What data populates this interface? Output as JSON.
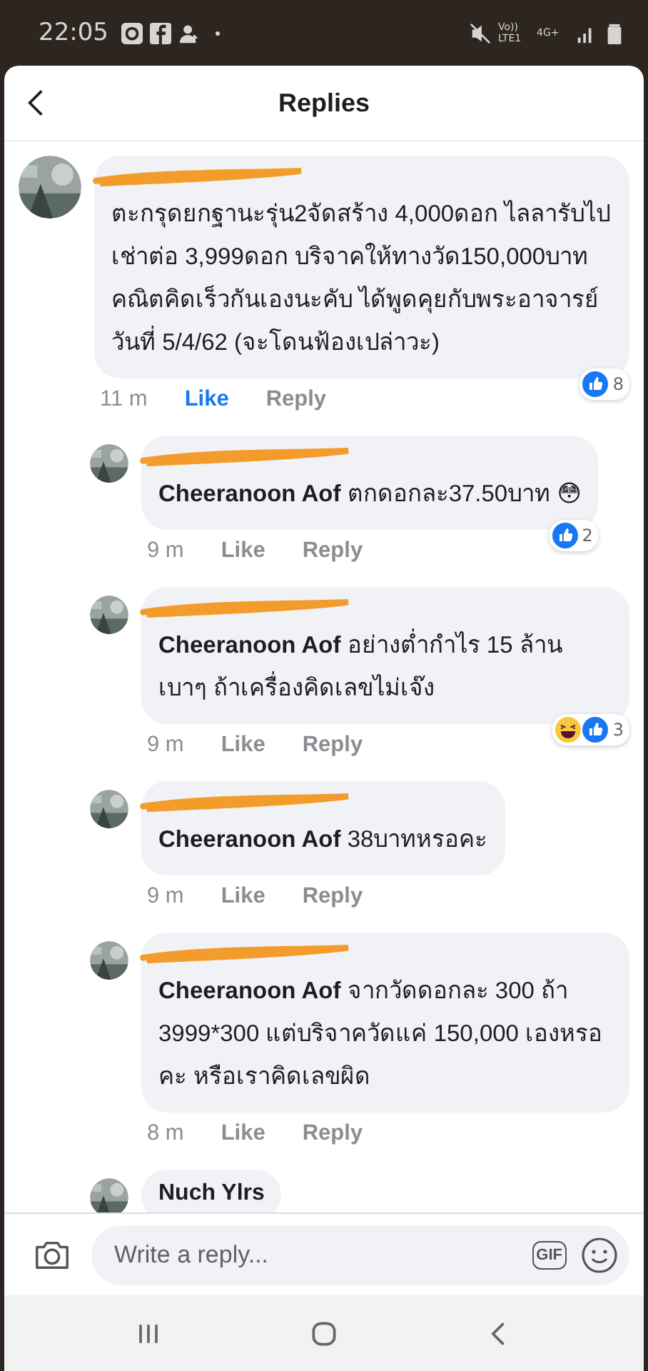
{
  "status_bar": {
    "time": "22:05",
    "volte": "Vo)) LTE1",
    "network_type": "4G+"
  },
  "header": {
    "title": "Replies"
  },
  "comments": [
    {
      "kind": "comment",
      "redacted": true,
      "text": "ตะกรุดยกฐานะรุ่น2จัดสร้าง 4,000ดอก ไลลารับไปเช่าต่อ 3,999ดอก บริจาคให้ทางวัด150,000บาท คณิตคิดเร็วกันเองนะคับ ได้พูดคุยกับพระอาจารย์วันที่ 5/4/62 (จะโดนฟ้องเปล่าวะ)",
      "time": "11 m",
      "like": "Like",
      "reply": "Reply",
      "liked": true,
      "reactions": [
        {
          "kind": "like"
        }
      ],
      "reaction_count": "8"
    },
    {
      "kind": "reply",
      "redacted": true,
      "text": "**Cheeranoon Aof** ตกดอกละ37.50บาท 😳",
      "time": "9 m",
      "like": "Like",
      "reply": "Reply",
      "liked": false,
      "reactions": [
        {
          "kind": "like"
        }
      ],
      "reaction_count": "2"
    },
    {
      "kind": "reply",
      "redacted": true,
      "text": "**Cheeranoon Aof** อย่างต่ำกำไร 15 ล้าน เบาๆ ถ้าเครื่องคิดเลขไม่เจ๊ง",
      "time": "9 m",
      "like": "Like",
      "reply": "Reply",
      "liked": false,
      "reactions": [
        {
          "kind": "haha"
        },
        {
          "kind": "like"
        }
      ],
      "reaction_count": "3"
    },
    {
      "kind": "reply",
      "redacted": true,
      "text": "**Cheeranoon Aof** 38บาทหรอคะ",
      "time": "9 m",
      "like": "Like",
      "reply": "Reply",
      "liked": false
    },
    {
      "kind": "reply",
      "redacted": true,
      "text": "**Cheeranoon Aof** จากวัดดอกละ 300 ถ้า 3999*300 แต่บริจาควัดแค่ 150,000 เองหรอคะ หรือเราคิดเลขผิด",
      "time": "8 m",
      "like": "Like",
      "reply": "Reply",
      "liked": false
    },
    {
      "kind": "reply",
      "redacted": false,
      "author": "Nuch Ylrs"
    }
  ],
  "composer": {
    "placeholder": "Write a reply...",
    "gif_label": "GIF"
  }
}
